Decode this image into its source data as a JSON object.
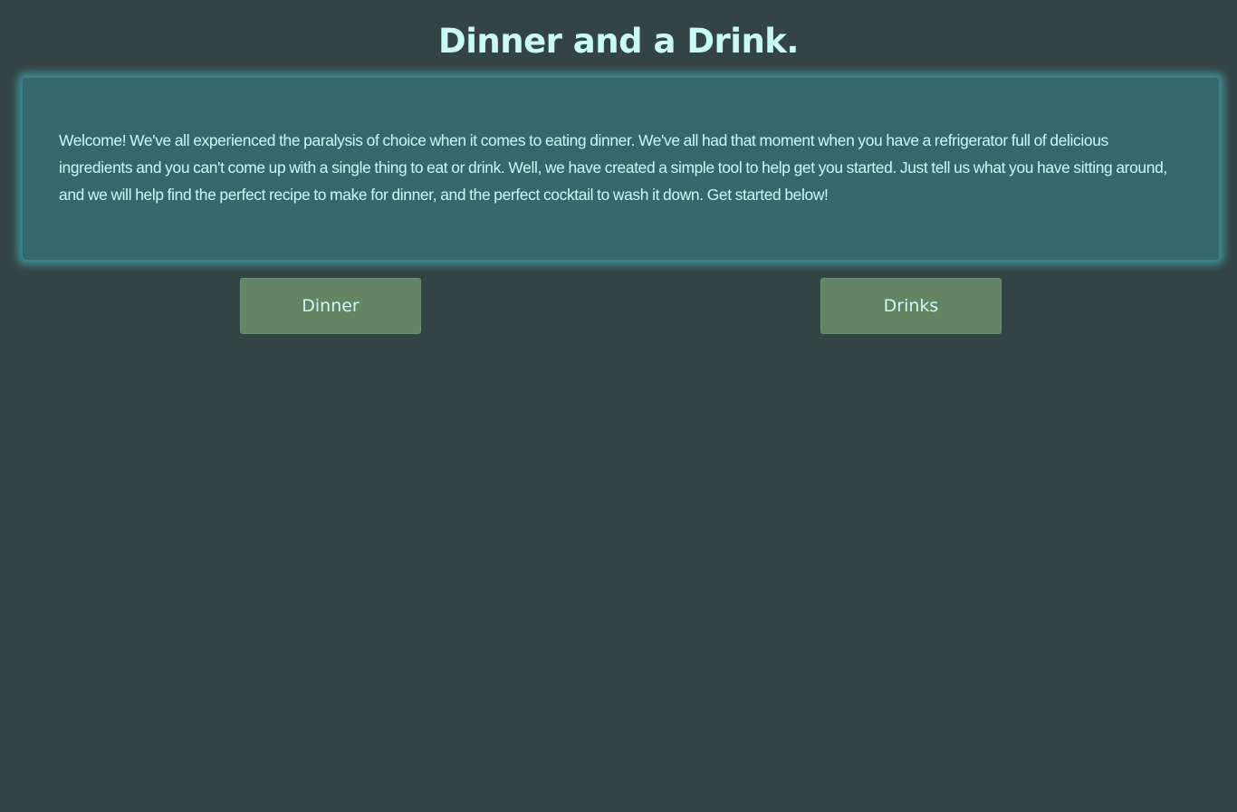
{
  "header": {
    "title": "Dinner and a Drink."
  },
  "welcome": {
    "text": "Welcome! We've all experienced the paralysis of choice when it comes to eating dinner. We've all had that moment when you have a refrigerator full of delicious ingredients and you can't come up with a single thing to eat or drink. Well, we have created a simple tool to help get you started. Just tell us what you have sitting around, and we will help find the perfect recipe to make for dinner, and the perfect cocktail to wash it down. Get started below!"
  },
  "buttons": {
    "dinner_label": "Dinner",
    "drinks_label": "Drinks"
  },
  "colors": {
    "background": "#344444",
    "card": "#33686d",
    "card_glow": "#3f8a92",
    "button": "#638563",
    "text": "#c9fbf6"
  }
}
